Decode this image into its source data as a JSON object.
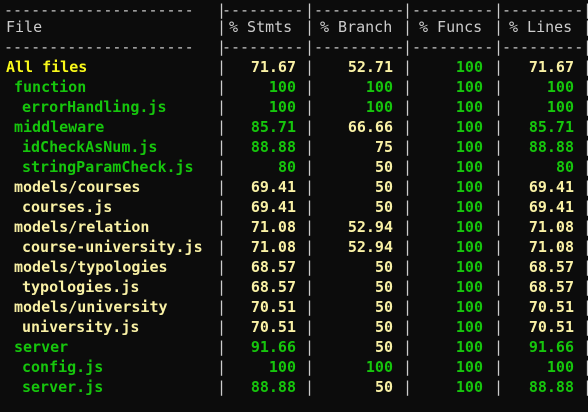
{
  "colors": {
    "background": "#0c0c0c",
    "text": "#cccccc",
    "high": "#16c60c",
    "medium": "#f9f1a5",
    "summary": "#f9f91a"
  },
  "headers": {
    "file": "File",
    "stmts": "% Stmts",
    "branch": "% Branch",
    "funcs": "% Funcs",
    "lines": "% Lines"
  },
  "dashes": {
    "file": "---------------------",
    "stmts": "---------",
    "branch": "----------",
    "funcs": "---------",
    "lines": "---------"
  },
  "rows": [
    {
      "file": "All files",
      "stmts": "71.67",
      "branch": "52.71",
      "funcs": "100",
      "lines": "71.67",
      "colors": [
        "summary",
        "medium",
        "medium",
        "high",
        "medium"
      ]
    },
    {
      "file": "function",
      "stmts": "100",
      "branch": "100",
      "funcs": "100",
      "lines": "100",
      "colors": [
        "high",
        "high",
        "high",
        "high",
        "high"
      ]
    },
    {
      "file": "errorHandling.js",
      "stmts": "100",
      "branch": "100",
      "funcs": "100",
      "lines": "100",
      "colors": [
        "high",
        "high",
        "high",
        "high",
        "high"
      ]
    },
    {
      "file": "middleware",
      "stmts": "85.71",
      "branch": "66.66",
      "funcs": "100",
      "lines": "85.71",
      "colors": [
        "high",
        "high",
        "medium",
        "high",
        "high"
      ]
    },
    {
      "file": "idCheckAsNum.js",
      "stmts": "88.88",
      "branch": "75",
      "funcs": "100",
      "lines": "88.88",
      "colors": [
        "high",
        "high",
        "medium",
        "high",
        "high"
      ]
    },
    {
      "file": "stringParamCheck.js",
      "stmts": "80",
      "branch": "50",
      "funcs": "100",
      "lines": "80",
      "colors": [
        "high",
        "high",
        "medium",
        "high",
        "high"
      ]
    },
    {
      "file": "models/courses",
      "stmts": "69.41",
      "branch": "50",
      "funcs": "100",
      "lines": "69.41",
      "colors": [
        "medium",
        "medium",
        "medium",
        "high",
        "medium"
      ]
    },
    {
      "file": "courses.js",
      "stmts": "69.41",
      "branch": "50",
      "funcs": "100",
      "lines": "69.41",
      "colors": [
        "medium",
        "medium",
        "medium",
        "high",
        "medium"
      ]
    },
    {
      "file": "models/relation",
      "stmts": "71.08",
      "branch": "52.94",
      "funcs": "100",
      "lines": "71.08",
      "colors": [
        "medium",
        "medium",
        "medium",
        "high",
        "medium"
      ]
    },
    {
      "file": "course-university.js",
      "stmts": "71.08",
      "branch": "52.94",
      "funcs": "100",
      "lines": "71.08",
      "colors": [
        "medium",
        "medium",
        "medium",
        "high",
        "medium"
      ]
    },
    {
      "file": "models/typologies",
      "stmts": "68.57",
      "branch": "50",
      "funcs": "100",
      "lines": "68.57",
      "colors": [
        "medium",
        "medium",
        "medium",
        "high",
        "medium"
      ]
    },
    {
      "file": "typologies.js",
      "stmts": "68.57",
      "branch": "50",
      "funcs": "100",
      "lines": "68.57",
      "colors": [
        "medium",
        "medium",
        "medium",
        "high",
        "medium"
      ]
    },
    {
      "file": "models/university",
      "stmts": "70.51",
      "branch": "50",
      "funcs": "100",
      "lines": "70.51",
      "colors": [
        "medium",
        "medium",
        "medium",
        "high",
        "medium"
      ]
    },
    {
      "file": "university.js",
      "stmts": "70.51",
      "branch": "50",
      "funcs": "100",
      "lines": "70.51",
      "colors": [
        "medium",
        "medium",
        "medium",
        "high",
        "medium"
      ]
    },
    {
      "file": "server",
      "stmts": "91.66",
      "branch": "50",
      "funcs": "100",
      "lines": "91.66",
      "colors": [
        "high",
        "high",
        "medium",
        "high",
        "high"
      ]
    },
    {
      "file": "config.js",
      "stmts": "100",
      "branch": "100",
      "funcs": "100",
      "lines": "100",
      "colors": [
        "high",
        "high",
        "high",
        "high",
        "high"
      ]
    },
    {
      "file": "server.js",
      "stmts": "88.88",
      "branch": "50",
      "funcs": "100",
      "lines": "88.88",
      "colors": [
        "high",
        "high",
        "medium",
        "high",
        "high"
      ]
    }
  ]
}
